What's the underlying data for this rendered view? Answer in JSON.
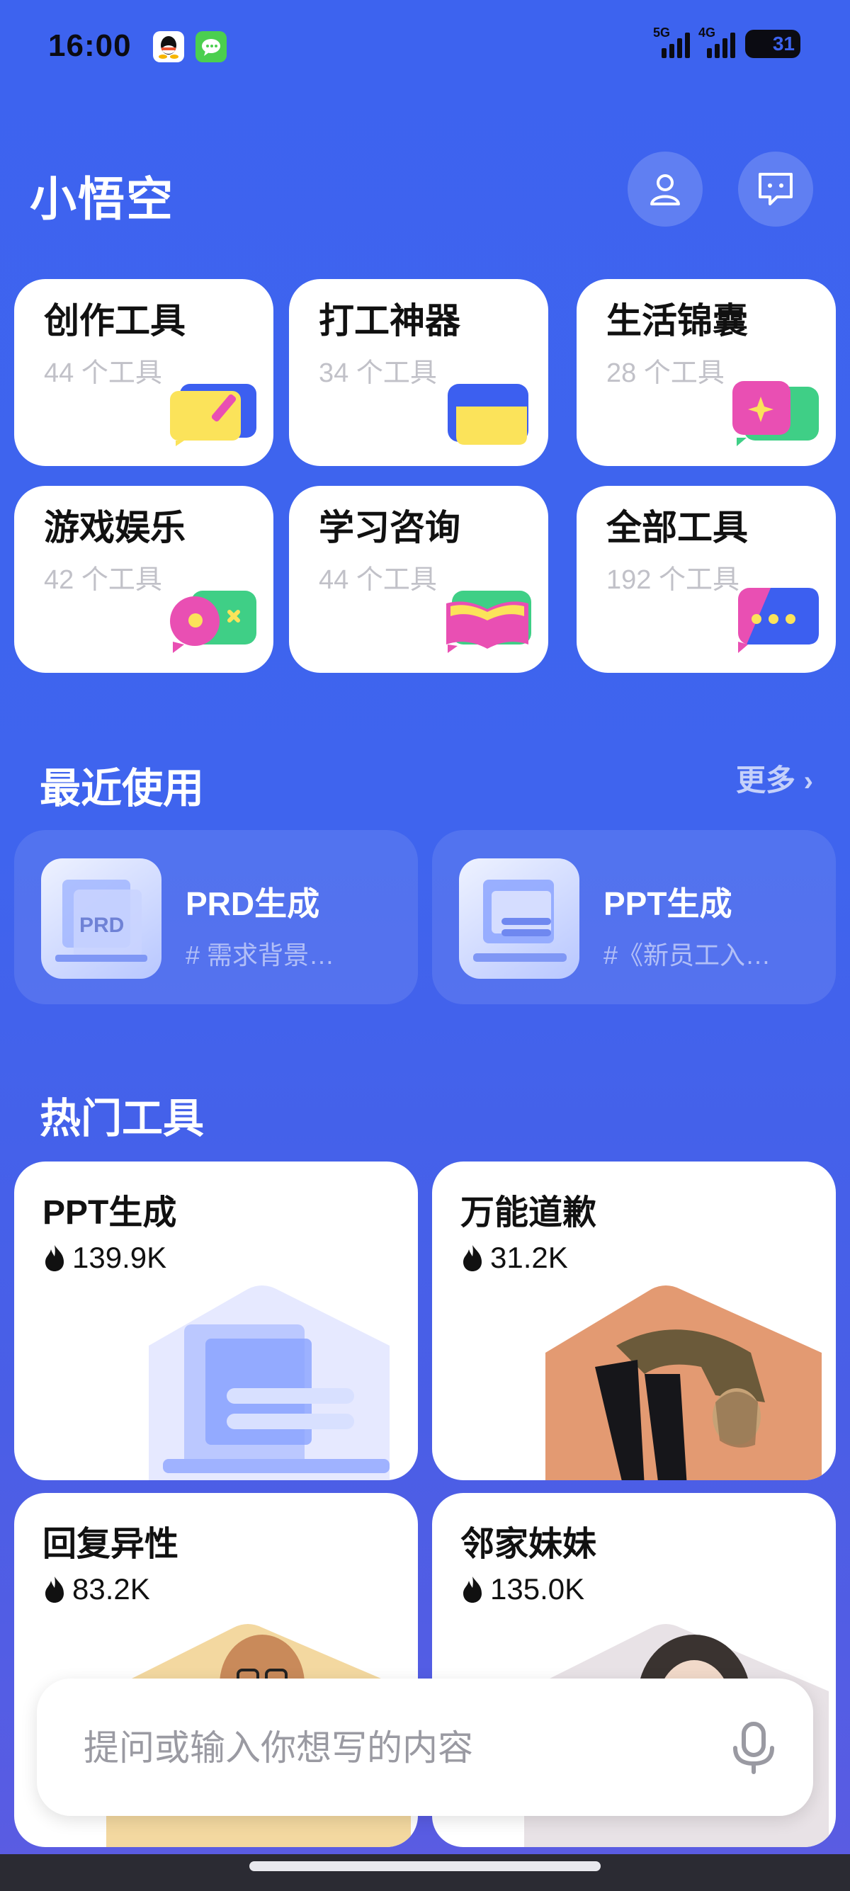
{
  "status_bar": {
    "time": "16:00",
    "signal_1": "5G",
    "signal_2": "4G",
    "battery": "31"
  },
  "header": {
    "title": "小悟空"
  },
  "categories": [
    {
      "name": "创作工具",
      "count": "44 个工具"
    },
    {
      "name": "打工神器",
      "count": "34 个工具"
    },
    {
      "name": "生活锦囊",
      "count": "28 个工具"
    },
    {
      "name": "游戏娱乐",
      "count": "42 个工具"
    },
    {
      "name": "学习咨询",
      "count": "44 个工具"
    },
    {
      "name": "全部工具",
      "count": "192 个工具"
    }
  ],
  "recent": {
    "title": "最近使用",
    "more": "更多",
    "items": [
      {
        "name": "PRD生成",
        "desc": "# 需求背景…",
        "thumb_text": "PRD"
      },
      {
        "name": "PPT生成",
        "desc": "#《新员工入…"
      }
    ]
  },
  "hot": {
    "title": "热门工具",
    "items": [
      {
        "name": "PPT生成",
        "count": "139.9K"
      },
      {
        "name": "万能道歉",
        "count": "31.2K"
      },
      {
        "name": "回复异性",
        "count": "83.2K"
      },
      {
        "name": "邻家妹妹",
        "count": "135.0K"
      }
    ]
  },
  "input": {
    "placeholder": "提问或输入你想写的内容"
  }
}
